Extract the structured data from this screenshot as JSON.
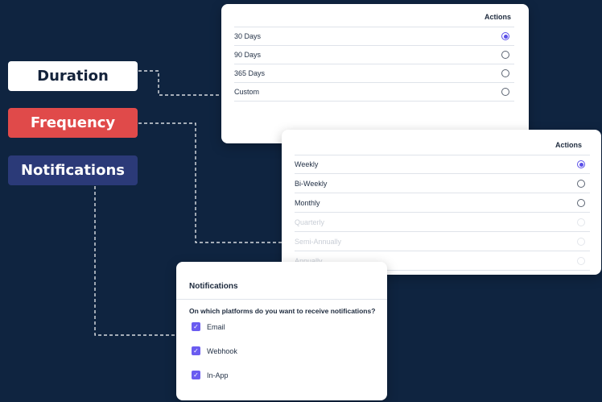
{
  "labels": {
    "duration": "Duration",
    "frequency": "Frequency",
    "notifications": "Notifications"
  },
  "duration_card": {
    "actions_header": "Actions",
    "rows": [
      {
        "label": "30 Days",
        "selected": true
      },
      {
        "label": "90 Days",
        "selected": false
      },
      {
        "label": "365 Days",
        "selected": false
      },
      {
        "label": "Custom",
        "selected": false
      }
    ]
  },
  "frequency_card": {
    "actions_header": "Actions",
    "rows": [
      {
        "label": "Weekly",
        "selected": true
      },
      {
        "label": "Bi-Weekly",
        "selected": false
      },
      {
        "label": "Monthly",
        "selected": false
      },
      {
        "label": "Quarterly",
        "selected": false,
        "faded": true
      },
      {
        "label": "Semi-Annually",
        "selected": false,
        "faded": true
      },
      {
        "label": "Annually",
        "selected": false,
        "faded": true
      }
    ]
  },
  "notifications_card": {
    "title": "Notifications",
    "question": "On which platforms do you want to receive notifications?",
    "options": [
      {
        "label": "Email",
        "checked": true
      },
      {
        "label": "Webhook",
        "checked": true
      },
      {
        "label": "In-App",
        "checked": true
      }
    ]
  },
  "colors": {
    "background": "#0f2440",
    "duration_pill": "#ffffff",
    "frequency_pill": "#e04a4a",
    "notifications_pill": "#2b3a78",
    "accent": "#5a4fe8"
  }
}
